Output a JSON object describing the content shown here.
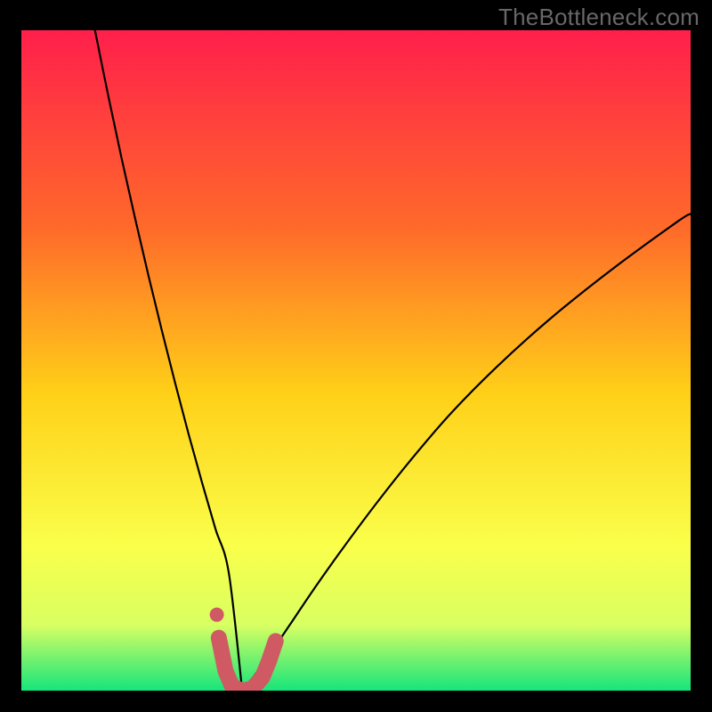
{
  "watermark": "TheBottleneck.com",
  "colors": {
    "frame": "#000000",
    "gradient_top": "#ff1f4b",
    "gradient_mid1": "#ff6a2a",
    "gradient_mid2": "#ffd018",
    "gradient_mid3": "#faff4a",
    "gradient_mid4": "#d9ff62",
    "gradient_bottom": "#16e57b",
    "curve": "#000000",
    "marker_fill": "#cf5a63",
    "marker_stroke": "#cf5a63",
    "watermark": "#676767"
  },
  "chart_data": {
    "type": "line",
    "title": "",
    "xlabel": "",
    "ylabel": "",
    "xlim": [
      0,
      100
    ],
    "ylim": [
      0,
      100
    ],
    "minimum": {
      "x": 33.0,
      "y": 0
    },
    "series": [
      {
        "name": "bottleneck-curve",
        "x": [
          11,
          13,
          15,
          17,
          19,
          21,
          23,
          25,
          27,
          29,
          31,
          33,
          35,
          37,
          40,
          44,
          48,
          53,
          58,
          64,
          71,
          79,
          88,
          98,
          100
        ],
        "y": [
          100,
          90.0,
          80.5,
          71.5,
          62.8,
          54.5,
          46.5,
          38.8,
          31.5,
          24.5,
          17.8,
          0.0,
          2.5,
          5.3,
          9.8,
          15.8,
          21.5,
          28.3,
          34.7,
          41.8,
          49.0,
          56.3,
          63.6,
          71.0,
          72.2
        ]
      }
    ],
    "marker_points": {
      "name": "highlight-band",
      "x": [
        29.5,
        30.5,
        31.5,
        33.0,
        34.5,
        36.0,
        37.0,
        38.0
      ],
      "y": [
        8.0,
        3.0,
        0.6,
        0.0,
        0.3,
        2.0,
        4.5,
        7.5
      ]
    }
  }
}
